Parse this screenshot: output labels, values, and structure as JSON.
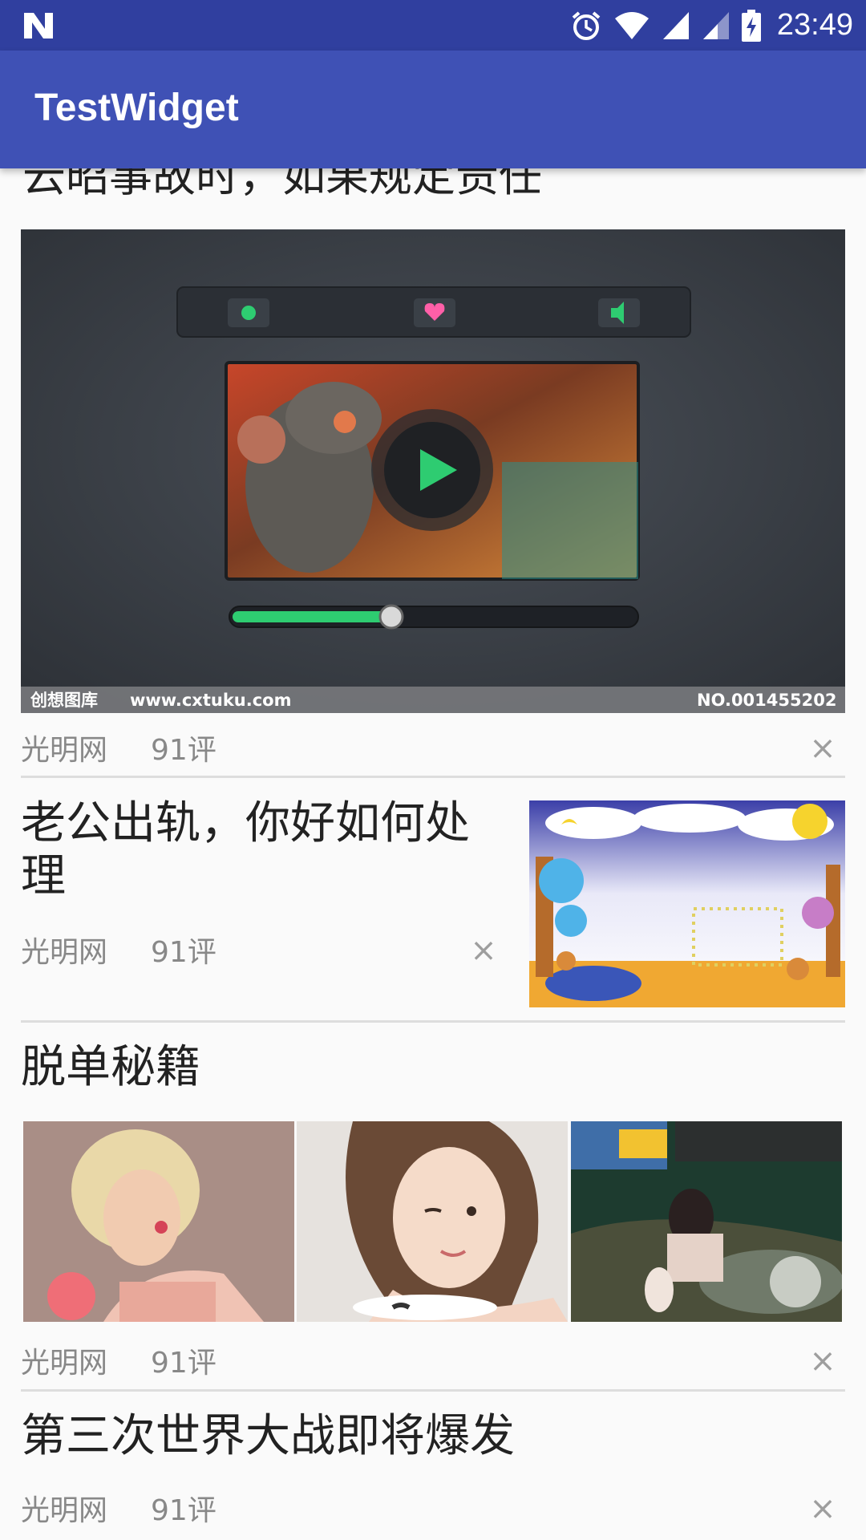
{
  "status_bar": {
    "time": "23:49",
    "icons": [
      "n-logo-icon",
      "alarm-icon",
      "wifi-icon",
      "signal-icon",
      "signal-weak-icon",
      "battery-charging-icon"
    ]
  },
  "app_bar": {
    "title": "TestWidget"
  },
  "colors": {
    "status_bar": "#303f9f",
    "app_bar": "#3f51b5",
    "background": "#fafafa"
  },
  "feed": {
    "partial_title": "云昭事故时，如果规定责任",
    "items": [
      {
        "type": "big-image",
        "image": {
          "watermark_left": "创想图库",
          "watermark_url": "www.cxtuku.com",
          "watermark_no": "NO.001455202",
          "player_progress": 0.38
        },
        "source": "光明网",
        "comments": "91评",
        "close": "×"
      },
      {
        "type": "right-image",
        "title": "老公出轨，你好如何处理",
        "source": "光明网",
        "comments": "91评",
        "close": "×"
      },
      {
        "type": "three-images",
        "title": "脱单秘籍",
        "source": "光明网",
        "comments": "91评",
        "close": "×"
      },
      {
        "type": "text-only",
        "title": "第三次世界大战即将爆发",
        "source": "光明网",
        "comments": "91评",
        "close": "×"
      }
    ]
  }
}
